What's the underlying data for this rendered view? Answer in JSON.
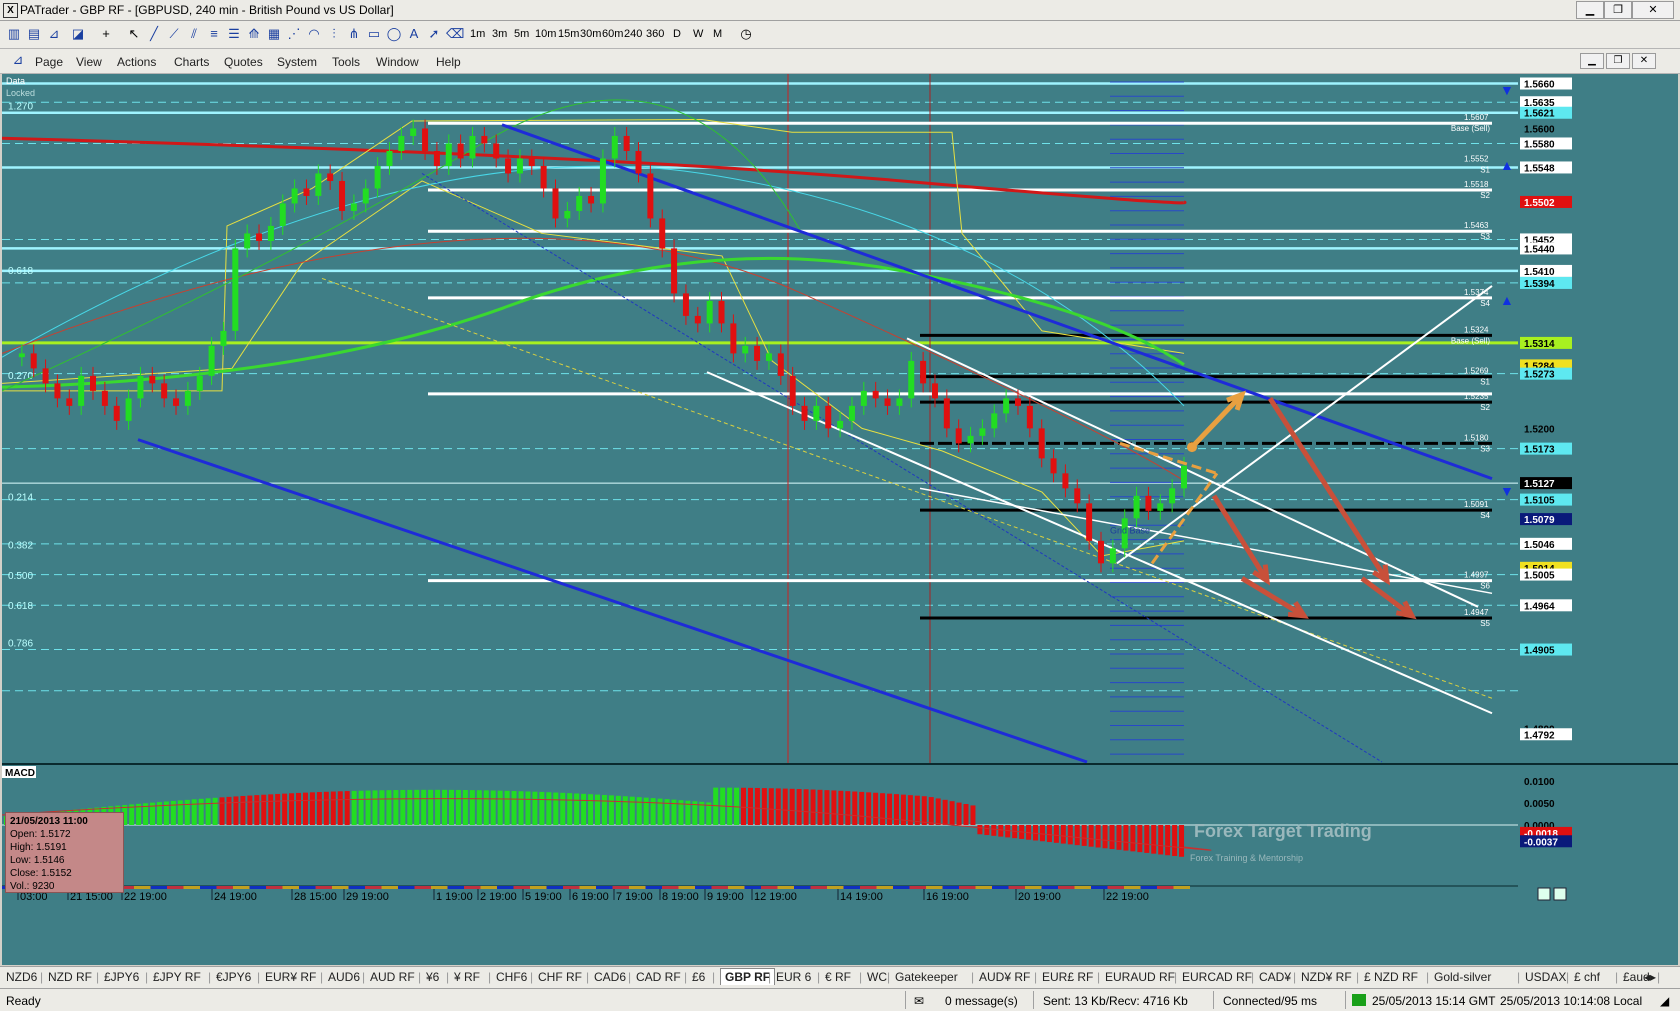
{
  "window": {
    "title": "PATrader - GBP RF - [GBPUSD, 240 min - British Pound vs US Dollar]",
    "app_icon": "X"
  },
  "toolbar": {
    "timeframes": [
      "1m",
      "3m",
      "5m",
      "10m",
      "15m",
      "30m",
      "60m",
      "240",
      "360",
      "D",
      "W",
      "M"
    ]
  },
  "menu": [
    "Page",
    "View",
    "Actions",
    "Charts",
    "Quotes",
    "System",
    "Tools",
    "Window",
    "Help"
  ],
  "chart": {
    "top_left_labels": [
      "Data",
      "Locked"
    ],
    "indicator_label": "MACD",
    "fib_labels": [
      {
        "text": "1.270",
        "price": 1.5621
      },
      {
        "text": "0.618",
        "price": 1.5402
      },
      {
        "text": "0.270",
        "price": 1.5262
      },
      {
        "text": "0.214",
        "price": 1.51
      },
      {
        "text": "0.382",
        "price": 1.5036
      },
      {
        "text": "0.500",
        "price": 1.4995
      },
      {
        "text": "0.618",
        "price": 1.4955
      },
      {
        "text": "0.786",
        "price": 1.4905
      }
    ],
    "price_axis": [
      {
        "text": "1.5660",
        "price": 1.566,
        "style": "white"
      },
      {
        "text": "1.5635",
        "price": 1.5635,
        "style": "white"
      },
      {
        "text": "1.5621",
        "price": 1.5621,
        "style": "cyan"
      },
      {
        "text": "1.5600",
        "price": 1.56,
        "style": "plain"
      },
      {
        "text": "1.5580",
        "price": 1.558,
        "style": "white"
      },
      {
        "text": "1.5548",
        "price": 1.5548,
        "style": "white"
      },
      {
        "text": "1.5502",
        "price": 1.5502,
        "style": "red"
      },
      {
        "text": "1.5452",
        "price": 1.5452,
        "style": "white"
      },
      {
        "text": "1.5440",
        "price": 1.544,
        "style": "white"
      },
      {
        "text": "1.5410",
        "price": 1.541,
        "style": "white"
      },
      {
        "text": "1.5394",
        "price": 1.5394,
        "style": "cyan"
      },
      {
        "text": "1.5314",
        "price": 1.5314,
        "style": "lime"
      },
      {
        "text": "1.5284",
        "price": 1.5284,
        "style": "yellow"
      },
      {
        "text": "1.5273",
        "price": 1.5273,
        "style": "cyan"
      },
      {
        "text": "1.5200",
        "price": 1.52,
        "style": "plain"
      },
      {
        "text": "1.5173",
        "price": 1.5173,
        "style": "cyan"
      },
      {
        "text": "1.5127",
        "price": 1.5127,
        "style": "black"
      },
      {
        "text": "1.5105",
        "price": 1.5105,
        "style": "cyan"
      },
      {
        "text": "1.5079",
        "price": 1.5079,
        "style": "navy"
      },
      {
        "text": "1.5046",
        "price": 1.5046,
        "style": "white"
      },
      {
        "text": "1.5014",
        "price": 1.5014,
        "style": "yellow"
      },
      {
        "text": "1.5005",
        "price": 1.5005,
        "style": "white"
      },
      {
        "text": "1.4964",
        "price": 1.4964,
        "style": "white"
      },
      {
        "text": "1.4905",
        "price": 1.4905,
        "style": "cyan"
      },
      {
        "text": "1.4800",
        "price": 1.48,
        "style": "plain"
      },
      {
        "text": "1.4792",
        "price": 1.4792,
        "style": "white"
      }
    ],
    "level_labels": [
      {
        "price": 1.5607,
        "value": "1.5607",
        "tag": "Base (Sell)"
      },
      {
        "price": 1.5552,
        "value": "1.5552",
        "tag": "S1"
      },
      {
        "price": 1.5518,
        "value": "1.5518",
        "tag": "S2"
      },
      {
        "price": 1.5463,
        "value": "1.5463",
        "tag": "S3"
      },
      {
        "price": 1.5374,
        "value": "1.5374",
        "tag": "S4"
      },
      {
        "price": 1.5324,
        "value": "1.5324",
        "tag": "Base (Sell)"
      },
      {
        "price": 1.5269,
        "value": "1.5269",
        "tag": "S1"
      },
      {
        "price": 1.5235,
        "value": "1.5235",
        "tag": "S2"
      },
      {
        "price": 1.518,
        "value": "1.5180",
        "tag": "S3"
      },
      {
        "price": 1.5091,
        "value": "1.5091",
        "tag": "S4"
      },
      {
        "price": 1.4997,
        "value": "1.4997",
        "tag": "S6"
      },
      {
        "price": 1.4947,
        "value": "1.4947",
        "tag": "S5"
      }
    ],
    "grid_base_label": "Grid Base",
    "macd_axis": [
      "0.0100",
      "0.0050",
      "0.0000",
      "-0.0018",
      "-0.0037"
    ],
    "time_axis": [
      "03:00",
      "21 15:00",
      "22 19:00",
      "24 19:00",
      "28 15:00",
      "29 19:00",
      "1 19:00",
      "2 19:00",
      "5 19:00",
      "6 19:00",
      "7 19:00",
      "8 19:00",
      "9 19:00",
      "12 19:00",
      "14 19:00",
      "16 19:00",
      "20 19:00",
      "22 19:00"
    ],
    "watermark": {
      "title": "Forex Target Trading",
      "subtitle": "Forex Training & Mentorship"
    },
    "ohlc": {
      "date": "21/05/2013 11:00",
      "open": "Open: 1.5172",
      "high": "High: 1.5191",
      "low": "Low: 1.5146",
      "close": "Close: 1.5152",
      "vol": "Vol.: 9230"
    },
    "colors": {
      "background": "#3f7e86",
      "bull": "#22dd22",
      "bear": "#e01010",
      "trend": "#1e2bd8",
      "accent_arrow_up": "#e8a040",
      "accent_arrow_down": "#c8503a"
    }
  },
  "tabs": [
    "NZD6",
    "NZD RF",
    "£JPY6",
    "£JPY RF",
    "€JPY6",
    "EUR¥ RF",
    "AUD6",
    "AUD RF",
    "¥6",
    "¥ RF",
    "CHF6",
    "CHF RF",
    "CAD6",
    "CAD RF",
    "£6",
    "GBP RF",
    "EUR 6",
    "€ RF",
    "WC",
    "Gatekeeper",
    "AUD¥ RF",
    "EUR£ RF",
    "EURAUD RF",
    "EURCAD RF",
    "CAD¥",
    "NZD¥ RF",
    "£ NZD RF",
    "Gold-silver",
    "USDAX",
    "£ chf",
    "£aud"
  ],
  "active_tab": "GBP RF",
  "status": {
    "ready": "Ready",
    "messages": "0 message(s)",
    "traffic": "Sent: 13 Kb/Recv: 4716 Kb",
    "connection": "Connected/95 ms",
    "gmt_time": "25/05/2013 15:14 GMT",
    "local_time": "25/05/2013 10:14:08 Local"
  }
}
